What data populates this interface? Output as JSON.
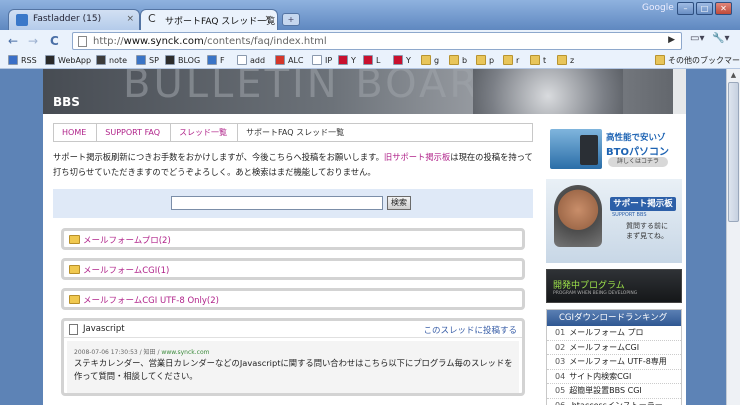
{
  "browser": {
    "tabs": [
      {
        "label": "Fastladder (15)",
        "active": false
      },
      {
        "label": "サポートFAQ スレッド一覧 - ...",
        "active": true
      }
    ],
    "new_tab": "+",
    "close_glyph": "×",
    "google_label": "Google",
    "url_prefix": "http://",
    "url_host": "www.synck.com",
    "url_path": "/contents/faq/index.html",
    "bookmarks": [
      {
        "label": "RSS",
        "color": "#3a6fc7"
      },
      {
        "label": "WebApp",
        "color": "#2a2a2a"
      },
      {
        "label": "note",
        "color": "#3c3c3c"
      },
      {
        "label": "SP",
        "color": "#3a74c6"
      },
      {
        "label": "BLOG",
        "color": "#2d2d2d"
      },
      {
        "label": "F",
        "color": "#3a74c6"
      },
      {
        "label": "add",
        "color": "#ffffff"
      },
      {
        "label": "ALC",
        "color": "#d4362a"
      },
      {
        "label": "IP",
        "color": "#ffffff"
      },
      {
        "label": "Y",
        "color": "#c8102e"
      },
      {
        "label": "L",
        "color": "#c8102e"
      },
      {
        "label": "Y",
        "color": "#c8102e"
      },
      {
        "label": "g",
        "color": "folder"
      },
      {
        "label": "b",
        "color": "folder"
      },
      {
        "label": "p",
        "color": "folder"
      },
      {
        "label": "r",
        "color": "folder"
      },
      {
        "label": "t",
        "color": "folder"
      },
      {
        "label": "z",
        "color": "folder"
      }
    ],
    "other_bookmarks": "その他のブックマーク"
  },
  "banner": {
    "bg_text": "BULLETIN BOARD",
    "title": "BBS"
  },
  "breadcrumb": [
    "HOME",
    "SUPPORT FAQ",
    "スレッド一覧",
    "サポートFAQ スレッド一覧"
  ],
  "intro": {
    "text1": "サポート掲示板刷新につきお手数をおかけしますが、今後こちらへ投稿をお願いします。",
    "link": "旧サポート掲示板",
    "text2": "は現在の投稿を持って打ち切らせていただきますのでどうぞよろしく。あと検索はまだ機能しておりません。"
  },
  "search": {
    "value": "",
    "button": "検索"
  },
  "forums": [
    {
      "label": "メールフォームプロ(2)"
    },
    {
      "label": "メールフォームCGI(1)"
    },
    {
      "label": "メールフォームCGI UTF-8 Only(2)"
    }
  ],
  "thread": {
    "title": "Javascript",
    "post_link": "このスレッドに投稿する",
    "meta_date": "2008-07-06 17:30:53 / 知田 / ",
    "meta_site": "www.synck.com",
    "text": "ステキカレンダー、営業日カレンダーなどのJavascriptに関する問い合わせはこちら以下にプログラム毎のスレッドを作って質問・相談してください。"
  },
  "sidebar": {
    "ad": {
      "line1": "高性能で安いゾ",
      "line2": "BTOパソコン",
      "line3": "詳しくはコチラ"
    },
    "support": {
      "title": "サポート掲示板",
      "sub": "SUPPORT BBS",
      "line1": "質問する前に",
      "line2": "まず見てね。"
    },
    "dev": {
      "title": "開発中プログラム",
      "sub": "PROGRAM WHEN BEING DEVELOPING"
    },
    "ranking": {
      "header": "CGIダウンロードランキング",
      "items": [
        {
          "num": "01",
          "label": "メールフォーム プロ"
        },
        {
          "num": "02",
          "label": "メールフォームCGI"
        },
        {
          "num": "03",
          "label": "メールフォーム UTF-8専用"
        },
        {
          "num": "04",
          "label": "サイト内検索CGI"
        },
        {
          "num": "05",
          "label": "超簡単設置BBS CGI"
        },
        {
          "num": "06",
          "label": ".htaccessインストーラー"
        }
      ]
    }
  }
}
